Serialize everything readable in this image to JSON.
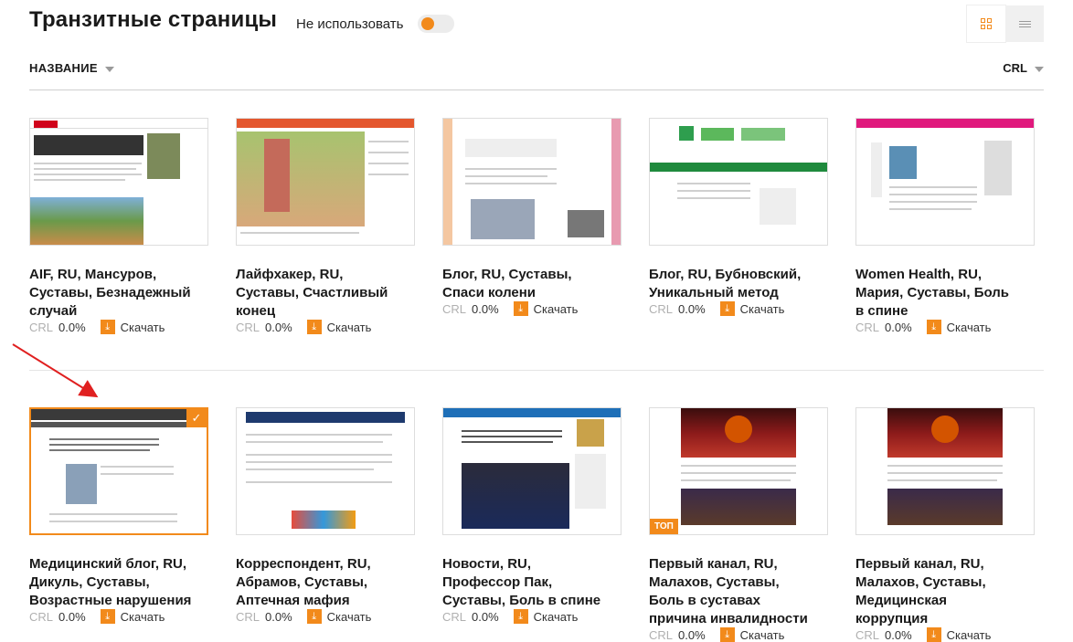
{
  "header": {
    "title": "Транзитные страницы",
    "toggle_label": "Не использовать"
  },
  "sort": {
    "left_label": "НАЗВАНИЕ",
    "right_label": "CRL"
  },
  "icons": {
    "grid": "grid-view-icon",
    "list": "list-view-icon",
    "download": "download-icon",
    "check": "check-icon",
    "caret": "caret-down-icon"
  },
  "colors": {
    "accent": "#f28a1b"
  },
  "cards": [
    {
      "title": "AIF, RU, Мансуров, Суставы, Безнадежный случай",
      "crl_label": "CRL",
      "crl": "0.0%",
      "download": "Скачать"
    },
    {
      "title": "Лайфхакер, RU, Суставы, Счастливый конец",
      "crl_label": "CRL",
      "crl": "0.0%",
      "download": "Скачать"
    },
    {
      "title": "Блог, RU, Суставы, Спаси колени",
      "crl_label": "CRL",
      "crl": "0.0%",
      "download": "Скачать"
    },
    {
      "title": "Блог, RU, Бубновский, Уникальный метод",
      "crl_label": "CRL",
      "crl": "0.0%",
      "download": "Скачать"
    },
    {
      "title": "Women Health, RU, Мария, Суставы, Боль в спине",
      "crl_label": "CRL",
      "crl": "0.0%",
      "download": "Скачать"
    },
    {
      "title": "Медицинский блог, RU, Дикуль, Суставы, Возрастные нарушения",
      "crl_label": "CRL",
      "crl": "0.0%",
      "download": "Скачать"
    },
    {
      "title": "Корреспондент, RU, Абрамов, Суставы, Аптечная мафия",
      "crl_label": "CRL",
      "crl": "0.0%",
      "download": "Скачать"
    },
    {
      "title": "Новости, RU, Профессор Пак, Суставы, Боль в спине",
      "crl_label": "CRL",
      "crl": "0.0%",
      "download": "Скачать"
    },
    {
      "title": "Первый канал, RU, Малахов, Суставы, Боль в суставах причина инвалидности",
      "crl_label": "CRL",
      "crl": "0.0%",
      "download": "Скачать",
      "badge": "ТОП"
    },
    {
      "title": "Первый канал, RU, Малахов, Суставы, Медицинская коррупция",
      "crl_label": "CRL",
      "crl": "0.0%",
      "download": "Скачать"
    }
  ]
}
